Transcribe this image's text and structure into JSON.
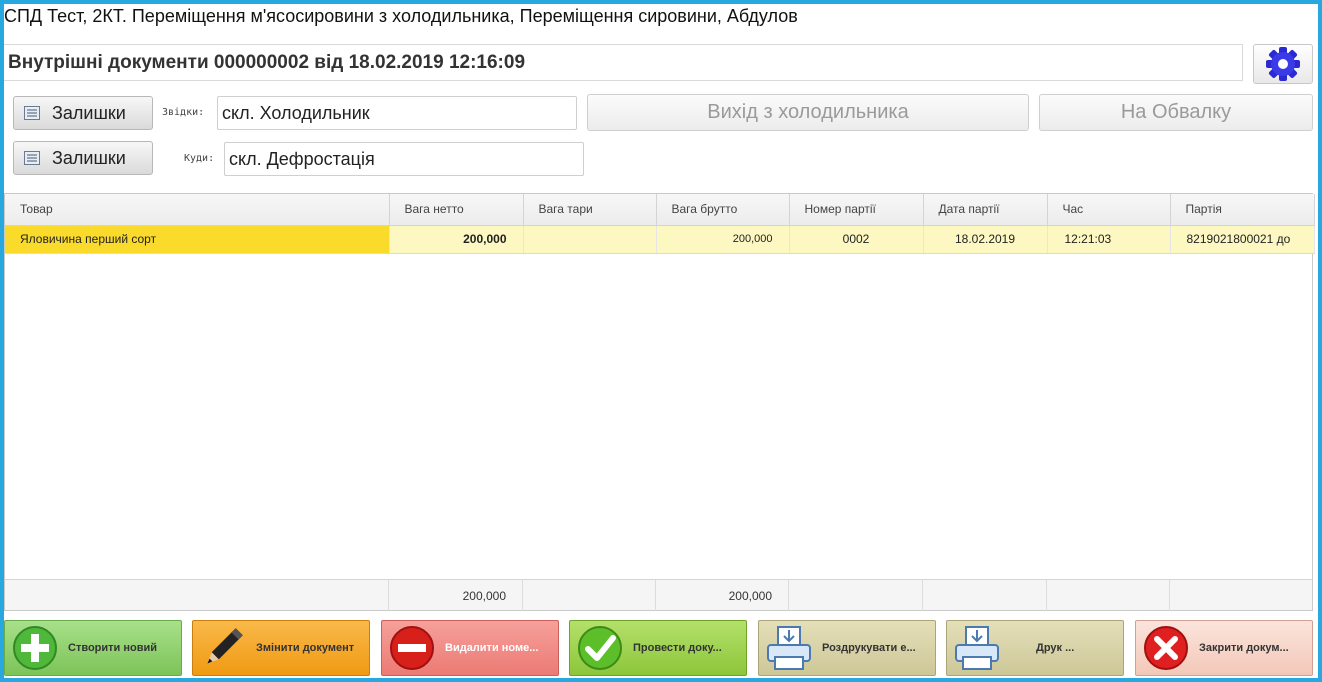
{
  "window_title": "СПД Тест, 2КТ. Переміщення м'ясосировини з холодильника, Переміщення сировини, Абдулов",
  "doc_header": "Внутрішні документи 000000002 від 18.02.2019 12:16:09",
  "settings_icon": "gear-icon",
  "from": {
    "button_label": "Залишки",
    "label": "Звідки:",
    "value": "скл. Холодильник"
  },
  "to": {
    "button_label": "Залишки",
    "label": "Куди:",
    "value": "скл. Дефростація"
  },
  "mode_buttons": [
    "Вихід з холодильника",
    "На Обвалку"
  ],
  "table": {
    "columns": [
      "Товар",
      "Вага нетто",
      "Вага тари",
      "Вага брутто",
      "Номер партії",
      "Дата партії",
      "Час",
      "Партія"
    ],
    "rows": [
      [
        "Яловичина перший сорт",
        "200,000",
        "",
        "200,000",
        "0002",
        "18.02.2019",
        "12:21:03",
        "8219021800021 до"
      ]
    ],
    "totals": [
      "",
      "200,000",
      "",
      "200,000",
      "",
      "",
      "",
      ""
    ]
  },
  "actions": [
    {
      "label": "Створити новий",
      "icon": "plus-icon",
      "color": "#8fd06a"
    },
    {
      "label": "Змінити документ",
      "icon": "pencil-icon",
      "color": "#f5a623"
    },
    {
      "label": "Видалити номе...",
      "icon": "minus-icon",
      "color": "#f08a85"
    },
    {
      "label": "Провести доку...",
      "icon": "check-icon",
      "color": "#9ccf4a"
    },
    {
      "label": "Роздрукувати е...",
      "icon": "printer-icon",
      "color": "#d8d3a8"
    },
    {
      "label": "Друк ...",
      "icon": "printer-icon",
      "color": "#d8d3a8"
    },
    {
      "label": "Закрити докум...",
      "icon": "close-icon",
      "color": "#f8d6cc"
    }
  ]
}
